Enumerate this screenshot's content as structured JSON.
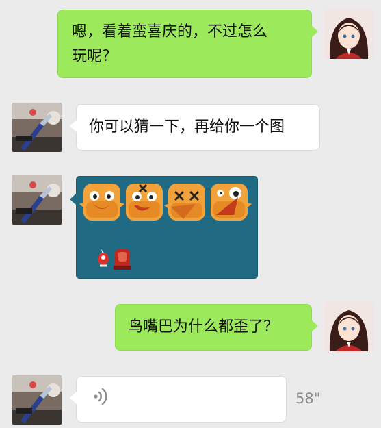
{
  "messages": [
    {
      "side": "right",
      "sender": "self",
      "text": "嗯，看着蛮喜庆的，不过怎么玩呢？",
      "line1": "嗯，看着蛮喜庆的，不过怎么",
      "line2": "玩呢？"
    },
    {
      "side": "left",
      "sender": "other",
      "text": "你可以猜一下，再给你一个图"
    },
    {
      "side": "left",
      "sender": "other",
      "type": "image",
      "content": "bird-sprites",
      "background": "#216a84"
    },
    {
      "side": "right",
      "sender": "self",
      "text": "鸟嘴巴为什么都歪了？"
    },
    {
      "side": "left",
      "sender": "other",
      "type": "voice",
      "icon": "voice-wave-icon",
      "duration": "58\""
    }
  ],
  "colors": {
    "background": "#ebebeb",
    "self_bubble": "#9de95c",
    "other_bubble": "#ffffff",
    "image_bg": "#216a84",
    "muted": "#8c8c8c"
  }
}
